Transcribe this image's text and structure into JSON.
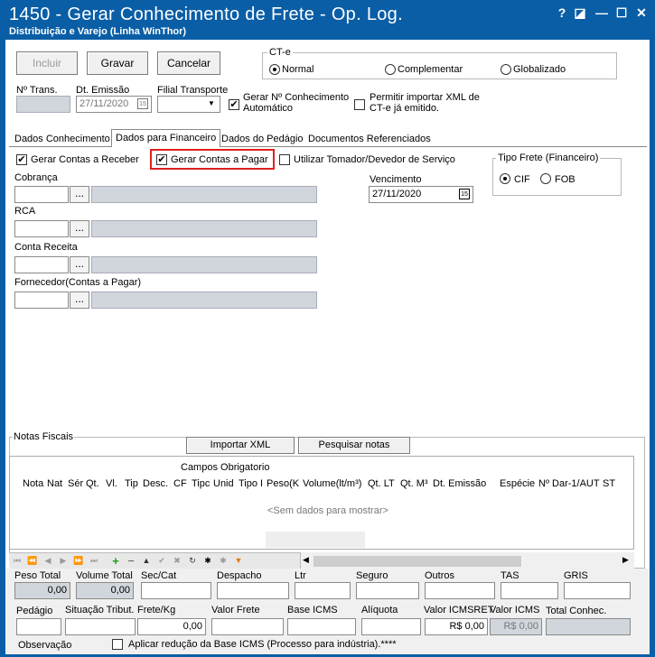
{
  "window": {
    "title": "1450 - Gerar Conhecimento de Frete - Op. Log.",
    "subtitle": "Distribuição e Varejo (Linha WinThor)",
    "help": "?",
    "restore": "◪",
    "minimize": "—",
    "maximize": "☐",
    "close": "✕"
  },
  "toolbar": {
    "incluir": "Incluir",
    "gravar": "Gravar",
    "cancelar": "Cancelar"
  },
  "cte": {
    "label": "CT-e",
    "options": [
      "Normal",
      "Complementar",
      "Globalizado"
    ],
    "selected": "Normal"
  },
  "header": {
    "ntrans_label": "Nº Trans.",
    "ntrans_value": "",
    "emissao_label": "Dt. Emissão",
    "emissao_value": "27/11/2020",
    "filial_label": "Filial Transporte",
    "filial_value": "",
    "gerar_num_label": "Gerar Nº Conhecimento Automático",
    "gerar_num_checked": true,
    "permitir_xml_label": "Permitir importar XML de CT-e já emitido.",
    "permitir_xml_checked": false
  },
  "tabs": [
    "Dados Conhecimento",
    "Dados para Financeiro",
    "Dados do Pedágio",
    "Documentos Referenciados"
  ],
  "selected_tab": "Dados para Financeiro",
  "financeiro": {
    "gerar_receber": "Gerar Contas a Receber",
    "gerar_pagar": "Gerar Contas a Pagar",
    "utilizar_tomador": "Utilizar Tomador/Devedor de Serviço",
    "cobranca": "Cobrança",
    "rca": "RCA",
    "conta_receita": "Conta Receita",
    "fornecedor": "Fornecedor(Contas a Pagar)",
    "vencimento_label": "Vencimento",
    "vencimento_value": "27/11/2020",
    "tipo_frete_label": "Tipo Frete (Financeiro)",
    "cif": "CIF",
    "fob": "FOB",
    "dots": "..."
  },
  "notas": {
    "label": "Notas Fiscais",
    "importar": "Importar XML",
    "pesquisar": "Pesquisar notas",
    "campos": "Campos Obrigatorio",
    "columns": [
      "Nota",
      "Nat",
      "Sér",
      "Qt.",
      "Vl.",
      "Tip",
      "Desc.",
      "CF",
      "Tipc",
      "Unid",
      "Tipo I",
      "Peso(K",
      "Volume(lt/m³)",
      "Qt. LT",
      "Qt. M³",
      "Dt. Emissão",
      "Espécie",
      "Nº Dar-1/AUT",
      "ST"
    ],
    "empty": "<Sem dados para mostrar>"
  },
  "totais": {
    "peso_total": "Peso Total",
    "peso_total_value": "0,00",
    "volume_total": "Volume Total",
    "volume_total_value": "0,00",
    "sec_cat": "Sec/Cat",
    "despacho": "Despacho",
    "ltr": "Ltr",
    "seguro": "Seguro",
    "outros": "Outros",
    "tas": "TAS",
    "gris": "GRIS",
    "pedagio": "Pedágio",
    "situacao": "Situação Tribut.",
    "frete_kg": "Frete/Kg",
    "frete_kg_value": "0,00",
    "valor_frete": "Valor Frete",
    "base_icms": "Base ICMS",
    "aliquota": "Alíquota",
    "valor_icmsret": "Valor ICMSRET",
    "valor_icmsret_value": "R$ 0,00",
    "valor_icms": "Valor ICMS",
    "valor_icms_value": "R$ 0,00",
    "total_conhec": "Total Conhec.",
    "observacao": "Observação",
    "aplicar_reducao": "Aplicar redução da Base ICMS (Processo para indústria).****"
  },
  "colors": {
    "title_bar": "#0a5ea6",
    "highlight": "#e02020",
    "readonly": "#d0d6dc"
  }
}
